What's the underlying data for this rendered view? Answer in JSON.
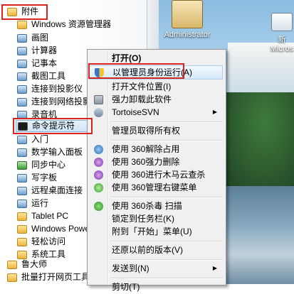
{
  "desktop": {
    "icons": [
      {
        "label": "Administrator"
      },
      {
        "label": "新\nMicros"
      }
    ]
  },
  "start_menu": {
    "items": [
      {
        "label": "附件",
        "icon": "folder-icon"
      },
      {
        "label": "Windows 资源管理器",
        "icon": "explorer-icon"
      },
      {
        "label": "画图",
        "icon": "paint-icon"
      },
      {
        "label": "计算器",
        "icon": "calculator-icon"
      },
      {
        "label": "记事本",
        "icon": "notepad-icon"
      },
      {
        "label": "截图工具",
        "icon": "snipping-tool-icon"
      },
      {
        "label": "连接到投影仪",
        "icon": "projector-icon"
      },
      {
        "label": "连接到网络投影仪",
        "icon": "network-projector-icon"
      },
      {
        "label": "录音机",
        "icon": "recorder-icon"
      },
      {
        "label": "命令提示符",
        "icon": "cmd-icon"
      },
      {
        "label": "入门",
        "icon": "getting-started-icon"
      },
      {
        "label": "数学输入面板",
        "icon": "math-panel-icon"
      },
      {
        "label": "同步中心",
        "icon": "sync-center-icon"
      },
      {
        "label": "写字板",
        "icon": "wordpad-icon"
      },
      {
        "label": "远程桌面连接",
        "icon": "remote-desktop-icon"
      },
      {
        "label": "运行",
        "icon": "run-icon"
      },
      {
        "label": "Tablet PC",
        "icon": "folder-icon"
      },
      {
        "label": "Windows PowerS",
        "icon": "folder-icon"
      },
      {
        "label": "轻松访问",
        "icon": "folder-icon"
      },
      {
        "label": "系统工具",
        "icon": "folder-icon"
      },
      {
        "label": "鲁大师",
        "icon": "folder-icon"
      },
      {
        "label": "批量打开网页工具",
        "icon": "folder-icon"
      }
    ]
  },
  "context_menu": {
    "items": [
      {
        "label": "打开(O)",
        "icon": ""
      },
      {
        "label": "以管理员身份运行(A)",
        "icon": "admin-shield-icon"
      },
      {
        "label": "打开文件位置(I)",
        "icon": ""
      },
      {
        "label": "强力卸载此软件",
        "icon": "uninstall-icon"
      },
      {
        "label": "TortoiseSVN",
        "icon": "tortoisesvn-icon"
      },
      {
        "label": "管理员取得所有权",
        "icon": ""
      },
      {
        "label": "使用 360解除占用",
        "icon": "360-unlock-icon"
      },
      {
        "label": "使用 360强力删除",
        "icon": "360-delete-icon"
      },
      {
        "label": "使用 360进行木马云查杀",
        "icon": "360-trojan-scan-icon"
      },
      {
        "label": "使用 360管理右键菜单",
        "icon": "360-manage-menu-icon"
      },
      {
        "label": "使用 360杀毒 扫描",
        "icon": "360-antivirus-icon"
      },
      {
        "label": "锁定到任务栏(K)",
        "icon": ""
      },
      {
        "label": "附到「开始」菜单(U)",
        "icon": ""
      },
      {
        "label": "还原以前的版本(V)",
        "icon": ""
      },
      {
        "label": "发送到(N)",
        "icon": ""
      },
      {
        "label": "剪切(T)",
        "icon": ""
      }
    ]
  },
  "colors": {
    "highlight_border": "#d9231e",
    "selection_fill": "#d6e9f9"
  }
}
